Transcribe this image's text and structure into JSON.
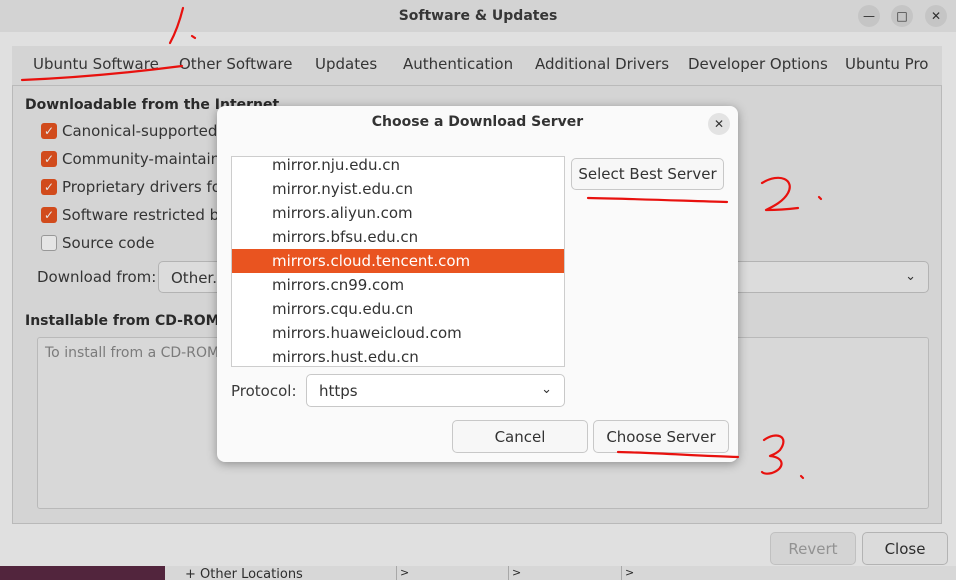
{
  "window": {
    "title": "Software & Updates",
    "minimize_icon": "minimize-icon",
    "maximize_icon": "maximize-icon",
    "close_icon": "close-icon"
  },
  "tabs": [
    {
      "label": "Ubuntu Software",
      "active": true
    },
    {
      "label": "Other Software"
    },
    {
      "label": "Updates"
    },
    {
      "label": "Authentication"
    },
    {
      "label": "Additional Drivers"
    },
    {
      "label": "Developer Options"
    },
    {
      "label": "Ubuntu Pro"
    }
  ],
  "downloadable": {
    "title": "Downloadable from the Internet",
    "items": [
      {
        "label": "Canonical-supported fr",
        "checked": true
      },
      {
        "label": "Community-maintained",
        "checked": true
      },
      {
        "label": "Proprietary drivers for c",
        "checked": true
      },
      {
        "label": "Software restricted by c",
        "checked": true
      },
      {
        "label": "Source code",
        "checked": false
      }
    ],
    "download_from_label": "Download from:",
    "download_from_value": "Other..."
  },
  "installable": {
    "title": "Installable from CD-ROM/DV",
    "placeholder": "To install from a CD-ROM c"
  },
  "footer": {
    "revert_label": "Revert",
    "close_label": "Close"
  },
  "background_strip": {
    "text": "+ Other Locations",
    "cells": [
      ">",
      ">",
      ">"
    ]
  },
  "dialog": {
    "title": "Choose a Download Server",
    "mirrors": [
      "mirror.nju.edu.cn",
      "mirror.nyist.edu.cn",
      "mirrors.aliyun.com",
      "mirrors.bfsu.edu.cn",
      "mirrors.cloud.tencent.com",
      "mirrors.cn99.com",
      "mirrors.cqu.edu.cn",
      "mirrors.huaweicloud.com",
      "mirrors.hust.edu.cn"
    ],
    "selected_mirror": "mirrors.cloud.tencent.com",
    "select_best_label": "Select Best Server",
    "protocol_label": "Protocol:",
    "protocol_value": "https",
    "cancel_label": "Cancel",
    "choose_label": "Choose Server"
  },
  "annotations": {
    "step1": "1.",
    "step2": "2.",
    "step3": "3.",
    "color": "#e8110e"
  },
  "colors": {
    "accent": "#e95420"
  }
}
